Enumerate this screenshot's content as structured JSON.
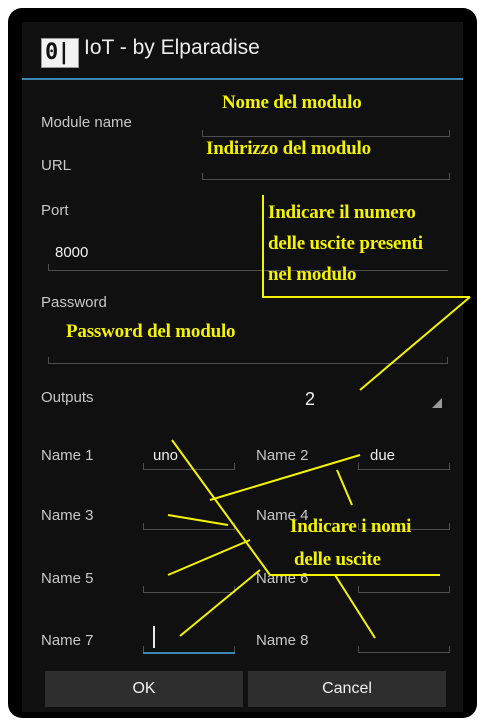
{
  "titlebar": {
    "icon_text": "0|",
    "title": "IoT - by Elparadise"
  },
  "form": {
    "module_name_label": "Module name",
    "url_label": "URL",
    "port_label": "Port",
    "port_value": "8000",
    "password_label": "Password",
    "outputs_label": "Outputs",
    "outputs_value": "2",
    "name_fields": [
      {
        "label": "Name 1",
        "value": "uno"
      },
      {
        "label": "Name 2",
        "value": "due"
      },
      {
        "label": "Name 3",
        "value": ""
      },
      {
        "label": "Name 4",
        "value": ""
      },
      {
        "label": "Name 5",
        "value": ""
      },
      {
        "label": "Name 6",
        "value": ""
      },
      {
        "label": "Name 7",
        "value": ""
      },
      {
        "label": "Name 8",
        "value": ""
      }
    ]
  },
  "buttons": {
    "ok": "OK",
    "cancel": "Cancel"
  },
  "annotations": {
    "module_name": "Nome del modulo",
    "url": "Indirizzo del modulo",
    "outputs_line1": "Indicare il numero",
    "outputs_line2": "delle uscite presenti",
    "outputs_line3": "nel modulo",
    "password": "Password del modulo",
    "names_line1": "Indicare i nomi",
    "names_line2": "delle uscite"
  },
  "colors": {
    "accent": "#3c86b3",
    "annotation": "#f5f300",
    "background": "#101010"
  }
}
